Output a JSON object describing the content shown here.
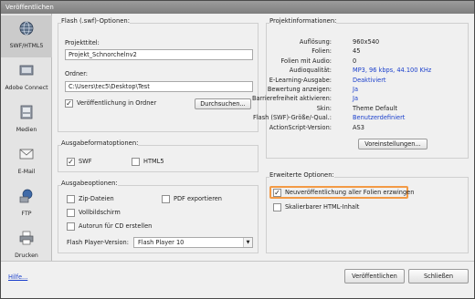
{
  "window": {
    "title": "Veröffentlichen"
  },
  "sidebar": {
    "items": [
      {
        "label": "SWF/HTML5",
        "icon": "globe-icon"
      },
      {
        "label": "Adobe Connect",
        "icon": "adobe-connect-icon"
      },
      {
        "label": "Medien",
        "icon": "media-icon"
      },
      {
        "label": "E-Mail",
        "icon": "envelope-icon"
      },
      {
        "label": "FTP",
        "icon": "ftp-icon"
      },
      {
        "label": "Drucken",
        "icon": "printer-icon"
      }
    ]
  },
  "flash_options": {
    "title": "Flash (.swf)-Optionen:",
    "project_title_label": "Projekttitel:",
    "project_title_value": "Projekt_Schnorchelnv2",
    "folder_label": "Ordner:",
    "folder_value": "C:\\Users\\tec5\\Desktop\\Test",
    "publish_in_folder_label": "Veröffentlichung in Ordner",
    "publish_in_folder_checked": true,
    "browse_label": "Durchsuchen..."
  },
  "output_format": {
    "title": "Ausgabeformatoptionen:",
    "swf_label": "SWF",
    "swf_checked": true,
    "html5_label": "HTML5",
    "html5_checked": false
  },
  "output_options": {
    "title": "Ausgabeoptionen:",
    "zip_label": "Zip-Dateien",
    "pdf_label": "PDF exportieren",
    "fullscreen_label": "Vollbildschirm",
    "autorun_label": "Autorun für CD erstellen",
    "player_version_label": "Flash Player-Version:",
    "player_version_value": "Flash Player 10"
  },
  "project_info": {
    "title": "Projektinformationen:",
    "rows": [
      {
        "key": "Auflösung:",
        "value": "960x540",
        "link": false
      },
      {
        "key": "Folien:",
        "value": "45",
        "link": false
      },
      {
        "key": "Folien mit Audio:",
        "value": "0",
        "link": false
      },
      {
        "key": "Audioqualität:",
        "value": "MP3, 96 kbps, 44.100 KHz",
        "link": true
      },
      {
        "key": "E-Learning-Ausgabe:",
        "value": "Deaktiviert",
        "link": true
      },
      {
        "key": "Bewertung anzeigen:",
        "value": "Ja",
        "link": true
      },
      {
        "key": "Barrierefreiheit aktivieren:",
        "value": "Ja",
        "link": true
      },
      {
        "key": "Skin:",
        "value": "Theme Default",
        "link": false
      },
      {
        "key": "Flash (SWF)-Größe/-Qual.:",
        "value": "Benutzerdefiniert",
        "link": true
      },
      {
        "key": "ActionScript-Version:",
        "value": "AS3",
        "link": false
      }
    ],
    "preferences_label": "Voreinstellungen..."
  },
  "advanced": {
    "title": "Erweiterte Optionen:",
    "republish_label": "Neuveröffentlichung aller Folien erzwingen",
    "republish_checked": true,
    "scalable_label": "Skalierbarer HTML-Inhalt",
    "scalable_checked": false
  },
  "footer": {
    "help_label": "Hilfe...",
    "publish_label": "Veröffentlichen",
    "close_label": "Schließen"
  },
  "colors": {
    "accent_link": "#1a3fcc",
    "highlight": "#f39a45"
  }
}
